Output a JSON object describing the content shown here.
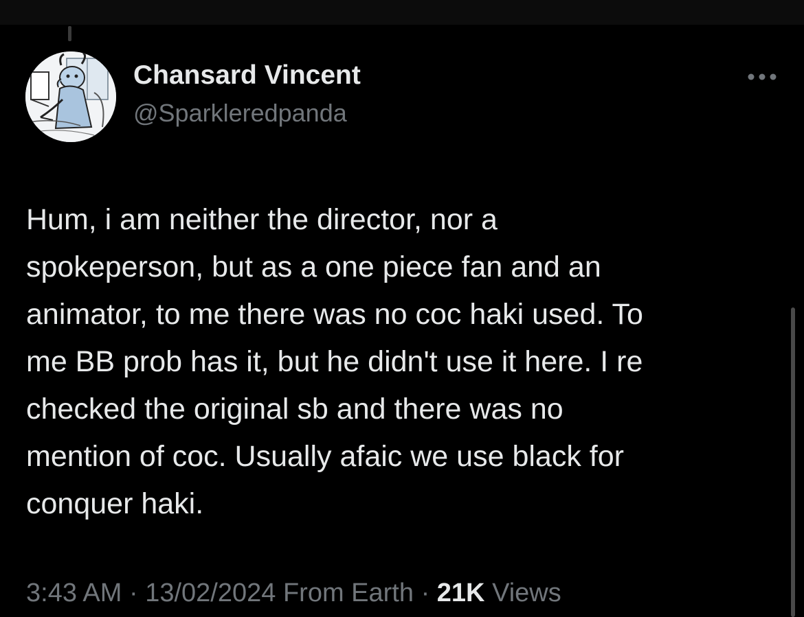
{
  "author": {
    "display_name": "Chansard Vincent",
    "handle": "@Sparkleredpanda"
  },
  "more_icon": "more-horizontal-icon",
  "avatar_icon": "avatar-drawing",
  "tweet": {
    "lines": [
      "Hum, i am neither the director, nor a",
      "spokeperson, but as a one piece fan and an",
      "animator, to me there was no coc haki used. To",
      "me BB prob has it, but he didn't use it here. I re",
      "checked the original sb and there was no",
      "mention of coc. Usually afaic we use black for",
      "conquer haki."
    ]
  },
  "meta": {
    "time": "3:43 AM",
    "separator": "·",
    "date": "13/02/2024",
    "source": "From Earth",
    "views_count": "21K",
    "views_label": "Views"
  },
  "colors": {
    "background": "#000000",
    "primary_text": "#e7e9ea",
    "secondary_text": "#71767b"
  }
}
